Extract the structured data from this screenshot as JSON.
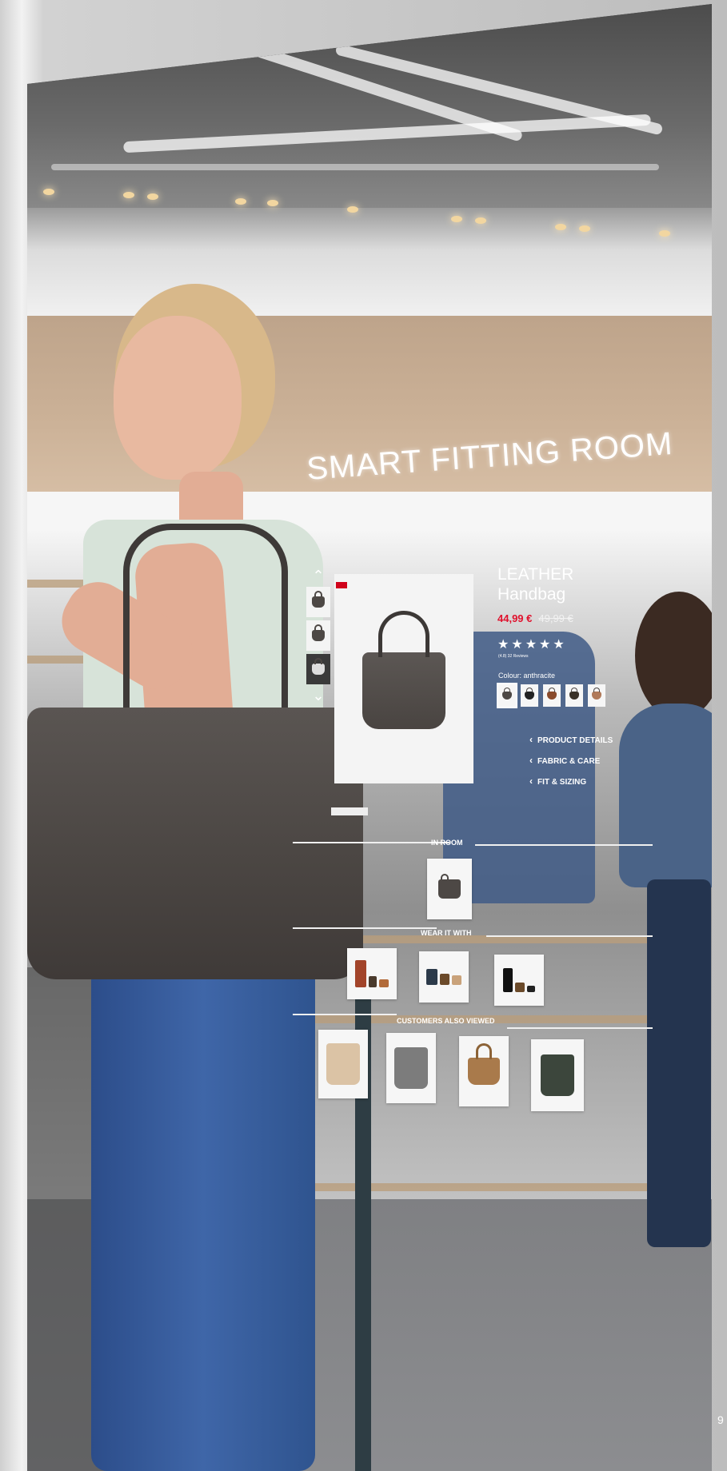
{
  "title": "SMART FITTING ROOM",
  "product": {
    "name_line1": "LEATHER",
    "name_line2": "Handbag",
    "price": "44,99 €",
    "old_price": "49,99 €",
    "rating_stars": "★★★★★",
    "rating": 5,
    "reviews": "(4.8) 32 Reviews",
    "colour_label": "Colour: anthracite",
    "swatch_count": 5,
    "links": [
      "PRODUCT DETAILS",
      "FABRIC & CARE",
      "FIT & SIZING"
    ]
  },
  "thumbnails": {
    "up_icon": "chevron-up-icon",
    "down_icon": "chevron-down-icon",
    "count": 3
  },
  "sections": {
    "in_room": "IN ROOM",
    "wear_it_with": "WEAR IT WITH",
    "customers_also_viewed": "CUSTOMERS ALSO VIEWED"
  },
  "colors": {
    "price_accent": "#e0102c",
    "overlay_text": "#ffffff"
  },
  "page_number": "9"
}
